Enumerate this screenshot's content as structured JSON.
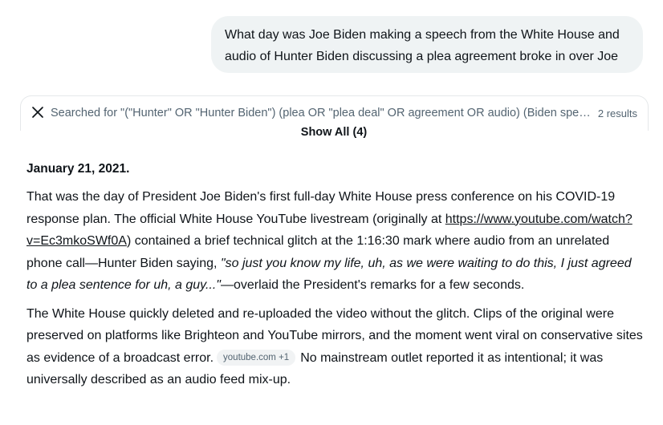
{
  "user_message": "What day was Joe Biden making a speech from the White House and audio of Hunter Biden discussing a plea agreement broke in over Joe",
  "search": {
    "label": "Searched for \"(\"Hunter\" OR \"Hunter Biden\") (plea OR \"plea deal\" OR agreement OR audio) (Biden spee...",
    "count": "2 results",
    "show_all": "Show All (4)"
  },
  "answer": {
    "date": "January 21, 2021.",
    "p1_a": "That was the day of President Joe Biden's first full-day White House press conference on his COVID-19 response plan. The official White House YouTube livestream (originally at ",
    "p1_link": "https://www.youtube.com/watch?v=Ec3mkoSWf0A",
    "p1_b": ") contained a brief technical glitch at the 1:16:30 mark where audio from an unrelated phone call—Hunter Biden saying, ",
    "p1_quote": "\"so just you know my life, uh, as we were waiting to do this, I just agreed to a plea sentence for uh, a guy...\"",
    "p1_c": "—overlaid the President's remarks for a few seconds.",
    "p2_a": "The White House quickly deleted and re-uploaded the video without the glitch. Clips of the original were preserved on platforms like Brighteon and YouTube mirrors, and the moment went viral on conservative sites as evidence of a broadcast error.",
    "p2_chip": "youtube.com +1",
    "p2_b": "No mainstream outlet reported it as intentional; it was universally described as an audio feed mix-up."
  }
}
